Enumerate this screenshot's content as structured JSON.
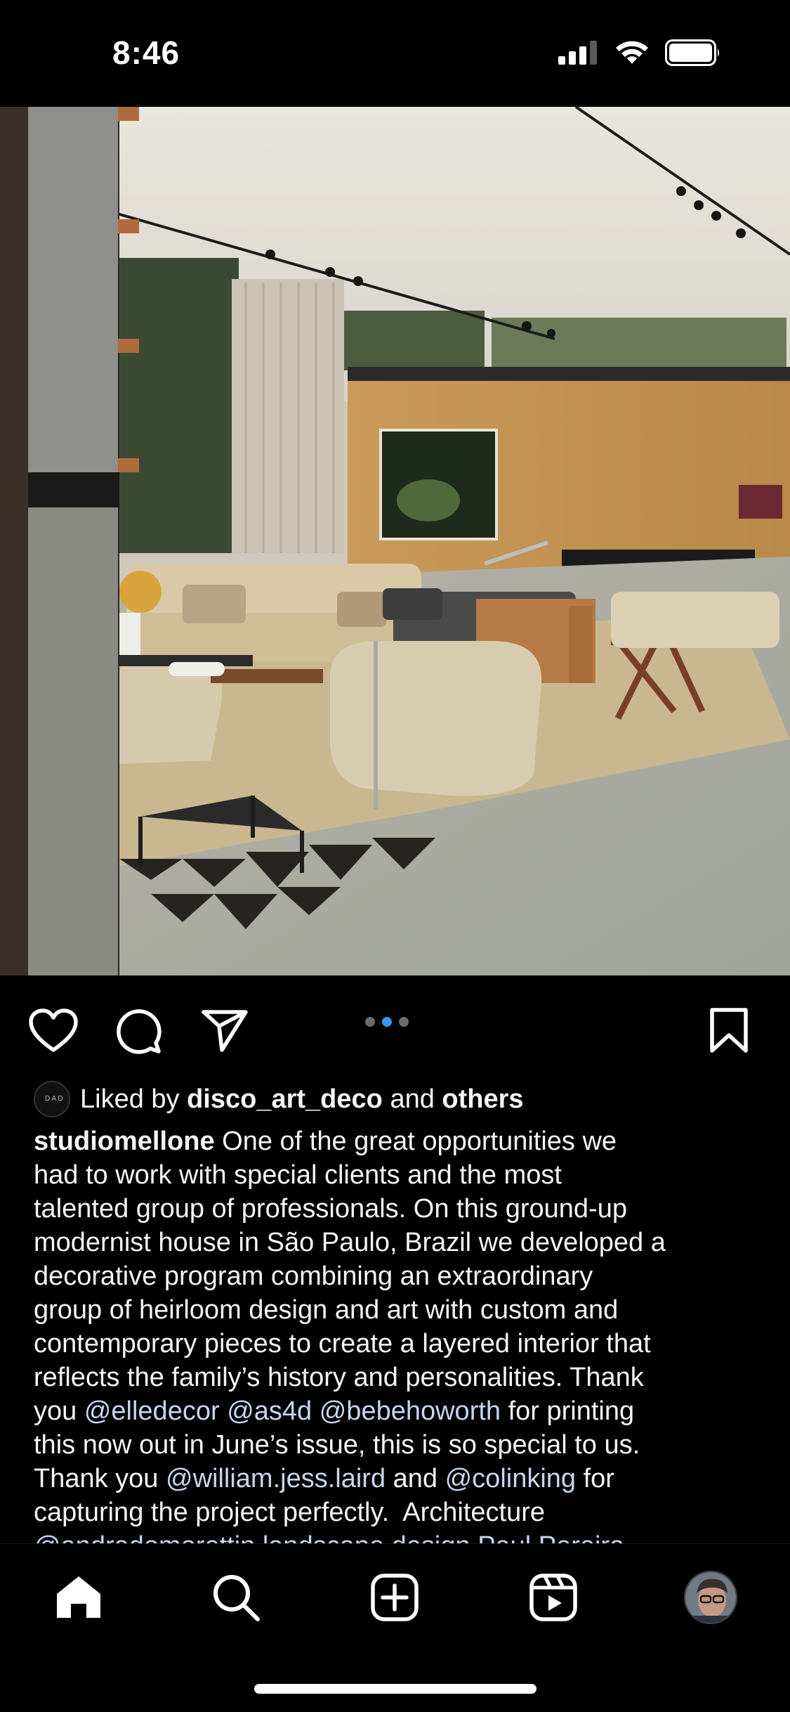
{
  "status_bar": {
    "time": "8:46",
    "icons": [
      "cellular-signal-icon",
      "wifi-icon",
      "battery-icon"
    ]
  },
  "post": {
    "carousel": {
      "count": 3,
      "active_index": 1
    },
    "actions": [
      "like-icon",
      "comment-icon",
      "share-icon",
      "bookmark-icon"
    ],
    "liked_by": {
      "prefix": "Liked by ",
      "user": "disco_art_deco",
      "middle": " and ",
      "suffix": "others",
      "avatar_text": "D A D"
    },
    "caption": {
      "username": "studiomellone",
      "lines": [
        [
          {
            "t": "studiomellone",
            "s": "bold"
          },
          {
            "t": " One of the great opportunities we",
            "s": "plain"
          }
        ],
        [
          {
            "t": "had to work with special clients and the most",
            "s": "plain"
          }
        ],
        [
          {
            "t": "talented group of professionals. On this ground-up",
            "s": "plain"
          }
        ],
        [
          {
            "t": "modernist house in São Paulo, Brazil we developed a",
            "s": "plain"
          }
        ],
        [
          {
            "t": "decorative program combining an extraordinary",
            "s": "plain"
          }
        ],
        [
          {
            "t": "group of heirloom design and art with custom and",
            "s": "plain"
          }
        ],
        [
          {
            "t": "contemporary pieces to create a layered interior that",
            "s": "plain"
          }
        ],
        [
          {
            "t": "reflects the family’s history and personalities. Thank",
            "s": "plain"
          }
        ],
        [
          {
            "t": "you ",
            "s": "plain"
          },
          {
            "t": "@elledecor",
            "s": "mention"
          },
          {
            "t": " ",
            "s": "plain"
          },
          {
            "t": "@as4d",
            "s": "mention"
          },
          {
            "t": " ",
            "s": "plain"
          },
          {
            "t": "@bebehoworth",
            "s": "mention"
          },
          {
            "t": " for printing",
            "s": "plain"
          }
        ],
        [
          {
            "t": "this now out in June’s issue, this is so special to us.",
            "s": "plain"
          }
        ],
        [
          {
            "t": "Thank you ",
            "s": "plain"
          },
          {
            "t": "@william.jess.laird",
            "s": "mention"
          },
          {
            "t": " and ",
            "s": "plain"
          },
          {
            "t": "@colinking",
            "s": "mention"
          },
          {
            "t": " for",
            "s": "plain"
          }
        ],
        [
          {
            "t": "capturing the project perfectly.  Architecture",
            "s": "plain"
          }
        ],
        [
          {
            "t": "@andradomorettin landscape design Paul Pereira",
            "s": "mention"
          }
        ]
      ]
    }
  },
  "bottom_nav": {
    "items": [
      "home-icon",
      "search-icon",
      "create-post-icon",
      "reels-icon",
      "profile-avatar"
    ],
    "active": "home-icon"
  }
}
